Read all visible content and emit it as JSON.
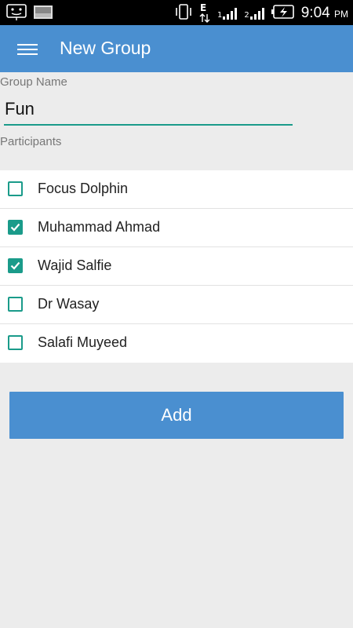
{
  "status_bar": {
    "time": "9:04",
    "ampm": "PM",
    "icons": [
      "android-face-icon",
      "image-notification-icon",
      "vibrate-icon",
      "data-e-icon",
      "signal-1-icon",
      "signal-2-icon",
      "battery-charging-icon"
    ],
    "network_type": "E",
    "sim1_label": "1",
    "sim2_label": "2"
  },
  "app_bar": {
    "title": "New Group",
    "menu_icon": "hamburger-menu-icon"
  },
  "form": {
    "group_name_label": "Group Name",
    "group_name_value": "Fun",
    "participants_label": "Participants"
  },
  "participants": [
    {
      "name": "Focus Dolphin",
      "checked": false
    },
    {
      "name": "Muhammad Ahmad",
      "checked": true
    },
    {
      "name": "Wajid Salfie",
      "checked": true
    },
    {
      "name": "Dr Wasay",
      "checked": false
    },
    {
      "name": "Salafi Muyeed",
      "checked": false
    }
  ],
  "actions": {
    "add_label": "Add"
  },
  "colors": {
    "primary": "#4a8fd0",
    "accent": "#1a9b8a",
    "background": "#ececec",
    "status_bar": "#000000"
  }
}
